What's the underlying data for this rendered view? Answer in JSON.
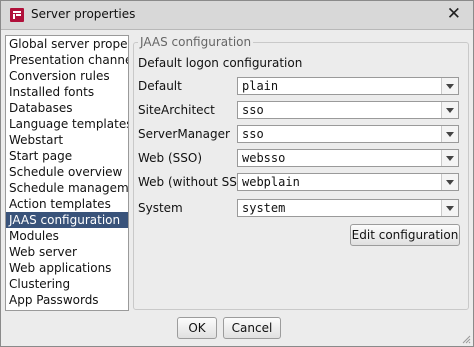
{
  "window": {
    "title": "Server properties",
    "close_label": "✕"
  },
  "nav": {
    "items": [
      {
        "label": "Global server properties"
      },
      {
        "label": "Presentation channels"
      },
      {
        "label": "Conversion rules"
      },
      {
        "label": "Installed fonts"
      },
      {
        "label": "Databases"
      },
      {
        "label": "Language templates"
      },
      {
        "label": "Webstart"
      },
      {
        "label": "Start page"
      },
      {
        "label": "Schedule overview"
      },
      {
        "label": "Schedule management"
      },
      {
        "label": "Action templates"
      },
      {
        "label": "JAAS configuration"
      },
      {
        "label": "Modules"
      },
      {
        "label": "Web server"
      },
      {
        "label": "Web applications"
      },
      {
        "label": "Clustering"
      },
      {
        "label": "App Passwords"
      }
    ],
    "selected": "JAAS configuration"
  },
  "panel": {
    "legend": "JAAS configuration",
    "heading": "Default logon configuration",
    "rows": [
      {
        "label": "Default",
        "value": "plain"
      },
      {
        "label": "SiteArchitect",
        "value": "sso"
      },
      {
        "label": "ServerManager",
        "value": "sso"
      },
      {
        "label": "Web (SSO)",
        "value": "websso"
      },
      {
        "label": "Web (without SSO)",
        "value": "webplain"
      },
      {
        "label": "System",
        "value": "system"
      }
    ],
    "edit_button": "Edit configuration"
  },
  "footer": {
    "ok": "OK",
    "cancel": "Cancel"
  },
  "colors": {
    "selection": "#39537a",
    "app_icon": "#b0103a"
  }
}
